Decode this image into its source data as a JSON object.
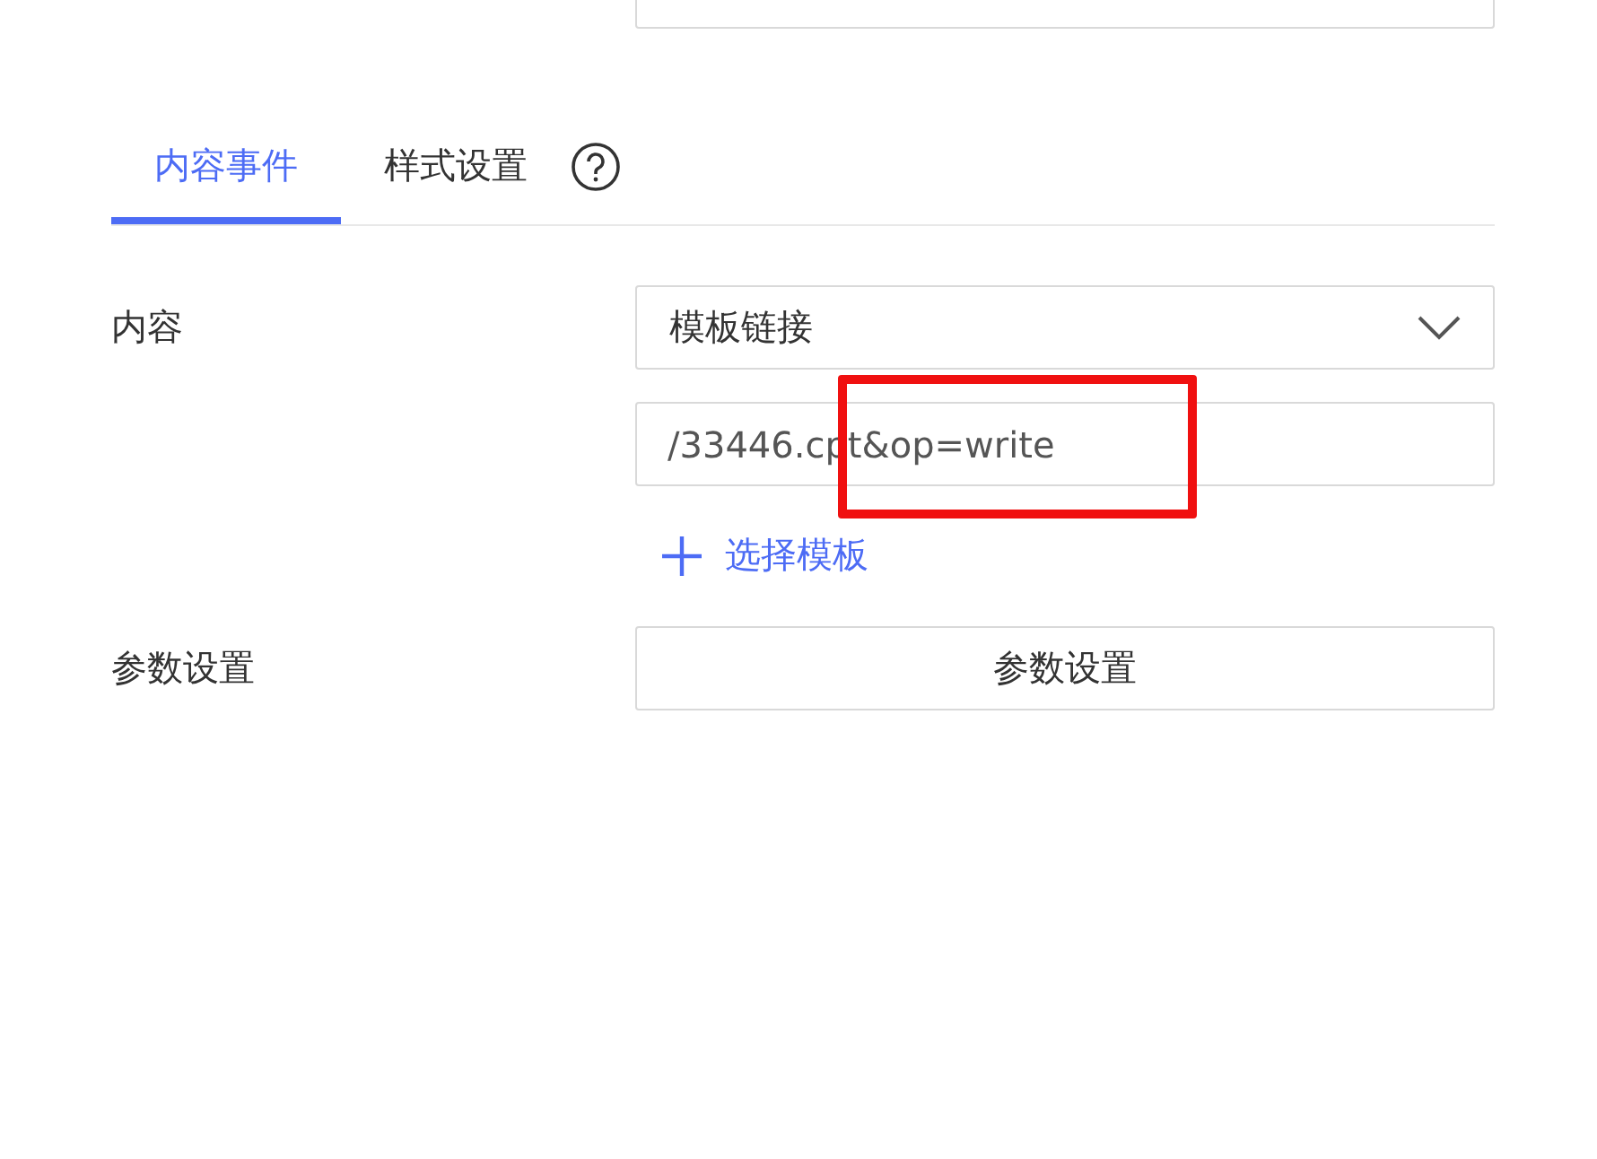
{
  "tabs": [
    {
      "label": "内容事件",
      "selected": true
    },
    {
      "label": "样式设置",
      "selected": false
    }
  ],
  "content": {
    "label": "内容",
    "select_value": "模板链接",
    "input_value": "/33446.cpt&op=write",
    "add_link": "选择模板"
  },
  "params": {
    "label": "参数设置",
    "button": "参数设置"
  }
}
